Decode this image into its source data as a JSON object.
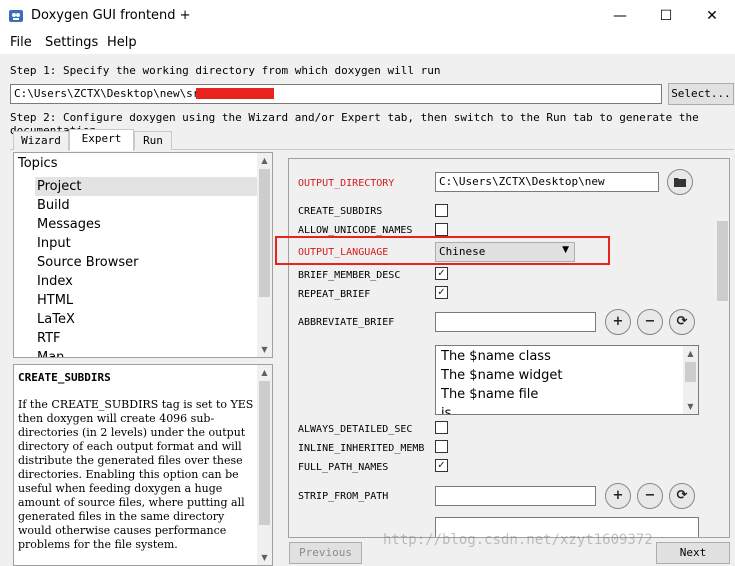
{
  "window": {
    "title": "Doxygen GUI frontend +",
    "minimize": "—",
    "maximize": "☐",
    "close": "✕"
  },
  "menu": [
    "File",
    "Settings",
    "Help"
  ],
  "step1": {
    "text": "Step 1: Specify the working directory from which doxygen will run",
    "dir_value": "C:\\Users\\ZCTX\\Desktop\\new\\src\\D",
    "select_label": "Select..."
  },
  "step2": {
    "text": "Step 2: Configure doxygen using the Wizard and/or Expert tab, then switch to the Run tab to generate the documentation"
  },
  "tabs": [
    "Wizard",
    "Expert",
    "Run"
  ],
  "active_tab": "Expert",
  "topics": {
    "header": "Topics",
    "items": [
      "Project",
      "Build",
      "Messages",
      "Input",
      "Source Browser",
      "Index",
      "HTML",
      "LaTeX",
      "RTF",
      "Man"
    ],
    "selected": "Project"
  },
  "help": {
    "title": "CREATE_SUBDIRS",
    "body": "If the CREATE_SUBDIRS tag is set to YES then doxygen will create 4096 sub-directories (in 2 levels) under the output directory of each output format and will distribute the generated files over these directories. Enabling this option can be useful when feeding doxygen a huge amount of source files, where putting all generated files in the same directory would otherwise causes performance problems for the file system."
  },
  "options": {
    "output_directory": {
      "label": "OUTPUT_DIRECTORY",
      "value": "C:\\Users\\ZCTX\\Desktop\\new"
    },
    "create_subdirs": {
      "label": "CREATE_SUBDIRS",
      "checked": false
    },
    "allow_unicode_names": {
      "label": "ALLOW_UNICODE_NAMES",
      "checked": false
    },
    "output_language": {
      "label": "OUTPUT_LANGUAGE",
      "value": "Chinese"
    },
    "brief_member_desc": {
      "label": "BRIEF_MEMBER_DESC",
      "checked": true
    },
    "repeat_brief": {
      "label": "REPEAT_BRIEF",
      "checked": true
    },
    "abbreviate_brief": {
      "label": "ABBREVIATE_BRIEF",
      "value": "",
      "list": [
        "The $name class",
        "The $name widget",
        "The $name file",
        "is"
      ]
    },
    "always_detailed_sec": {
      "label": "ALWAYS_DETAILED_SEC",
      "checked": false
    },
    "inline_inherited_memb": {
      "label": "INLINE_INHERITED_MEMB",
      "checked": false
    },
    "full_path_names": {
      "label": "FULL_PATH_NAMES",
      "checked": true
    },
    "strip_from_path": {
      "label": "STRIP_FROM_PATH",
      "value": ""
    }
  },
  "buttons": {
    "previous": "Previous",
    "next": "Next"
  },
  "watermark": "http://blog.csdn.net/xzyt1609372",
  "colors": {
    "highlight_red": "#e8221c",
    "label_red": "#d01c1c"
  }
}
